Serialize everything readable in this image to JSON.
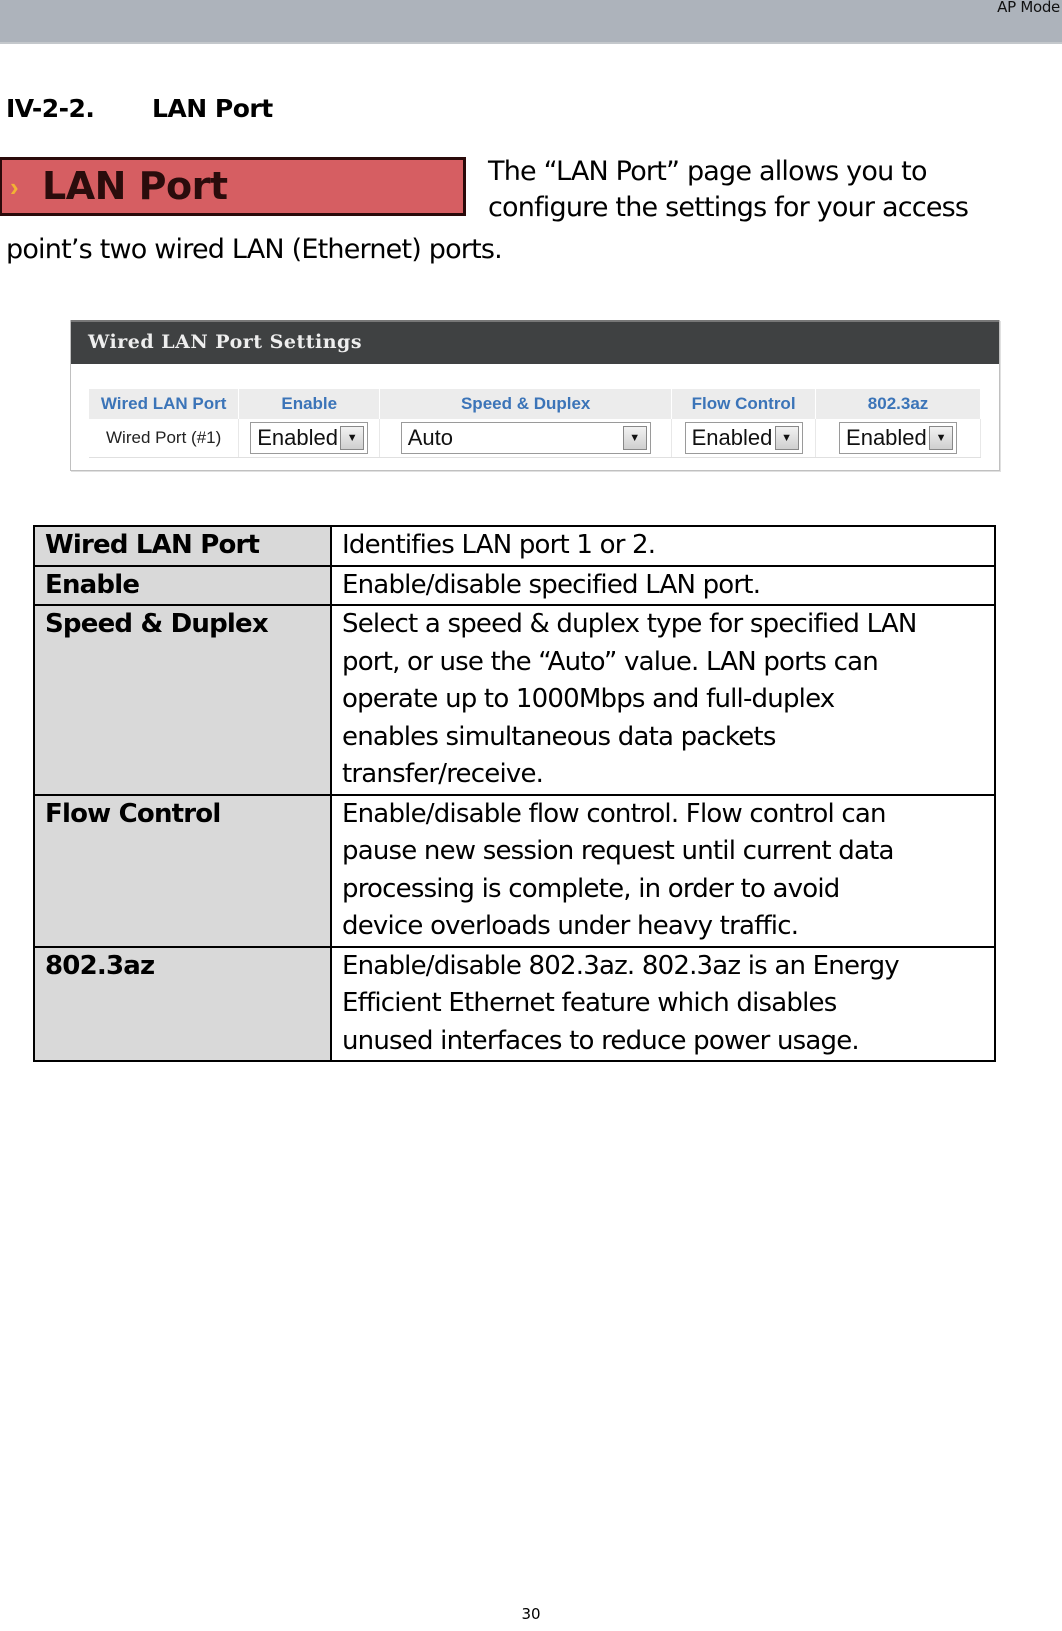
{
  "header": {
    "mode_label": "AP Mode"
  },
  "section": {
    "number": "IV-2-2.",
    "title": "LAN Port"
  },
  "banner": {
    "label": "LAN Port",
    "icon": "chevron-right-icon",
    "bg_color": "#d65e62",
    "chevron_color": "#f2b234"
  },
  "intro": {
    "line1": "The “LAN Port” page allows you to",
    "line2": "configure the settings for your access",
    "line3": "point’s two wired LAN (Ethernet) ports."
  },
  "settings_panel": {
    "title": "Wired LAN Port Settings",
    "columns": [
      "Wired LAN Port",
      "Enable",
      "Speed & Duplex",
      "Flow Control",
      "802.3az"
    ],
    "row": {
      "port": "Wired Port (#1)",
      "enable": "Enabled",
      "speed_duplex": "Auto",
      "flow_control": "Enabled",
      "az": "Enabled"
    },
    "header_color": "#3b74b8"
  },
  "description_table": [
    {
      "term": "Wired LAN Port",
      "lines": [
        "Identifies LAN port 1 or 2."
      ]
    },
    {
      "term": "Enable",
      "lines": [
        "Enable/disable specified LAN port."
      ]
    },
    {
      "term": "Speed & Duplex",
      "lines": [
        "Select a speed & duplex type for specified LAN",
        "port, or use the “Auto” value. LAN ports can",
        "operate up to 1000Mbps and full-duplex",
        "enables simultaneous data packets",
        "transfer/receive."
      ]
    },
    {
      "term": "Flow Control",
      "lines": [
        "Enable/disable flow control. Flow control can",
        "pause new session request until current data",
        "processing is complete, in order to avoid",
        "device overloads under heavy traffic."
      ]
    },
    {
      "term": "802.3az",
      "lines": [
        "Enable/disable 802.3az. 802.3az is an Energy",
        "Efficient Ethernet feature which disables",
        "unused interfaces to reduce power usage."
      ]
    }
  ],
  "footer": {
    "page_number": "30"
  }
}
